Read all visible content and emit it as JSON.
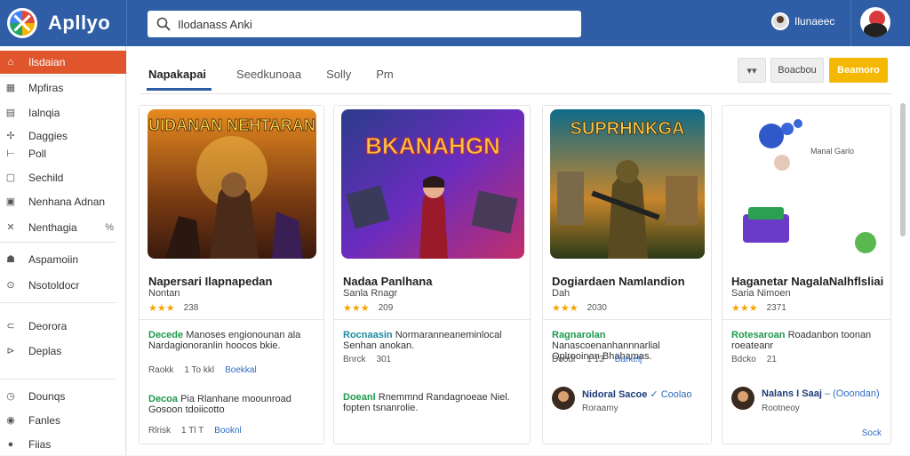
{
  "app": {
    "name": "Apllyo",
    "accent": "#2f5ea6",
    "active_color": "#e0552c",
    "primary_btn": "#f5b800"
  },
  "search": {
    "value": "Ilodanass Anki",
    "icon": "search-icon"
  },
  "user": {
    "name": "Ilunaeec"
  },
  "sidebar": {
    "items": [
      {
        "label": "Ilsdaian",
        "icon": "home-icon"
      },
      {
        "label": "Mpfiras",
        "icon": "grid-icon"
      },
      {
        "label": "Ialnqia",
        "icon": "list-icon"
      },
      {
        "label": "Daggies",
        "icon": "star-icon"
      },
      {
        "label": "Poll",
        "icon": "chart-icon"
      },
      {
        "label": "Sechild",
        "icon": "document-icon"
      },
      {
        "label": "Nenhana Adnan",
        "icon": "box-icon"
      },
      {
        "label": "Nenthagia",
        "icon": "cross-icon",
        "extra": "%"
      },
      {
        "label": "Aspamoiin",
        "icon": "user-icon"
      },
      {
        "label": "Nsotoldocr",
        "icon": "gear-icon"
      },
      {
        "label": "Deorora",
        "icon": "at-icon"
      },
      {
        "label": "Deplas",
        "icon": "share-icon"
      },
      {
        "label": "Dounqs",
        "icon": "clock-icon"
      },
      {
        "label": "Fanles",
        "icon": "circle-icon"
      },
      {
        "label": "Fiias",
        "icon": "dot-icon"
      }
    ]
  },
  "tabs": [
    {
      "label": "Napakapai"
    },
    {
      "label": "Seedkunoaa"
    },
    {
      "label": "Solly"
    },
    {
      "label": "Pm"
    }
  ],
  "toolbar": {
    "filter_label": "▾▾",
    "secondary_label": "Boacbou",
    "primary_label": "Beamoro"
  },
  "cards": [
    {
      "banner": "UIDANAN NEHTARAN",
      "colors": [
        "#7a3b12",
        "#e78a1f",
        "#3a1a0e"
      ],
      "title": "Napersari Ilapnapedan",
      "subtitle": "Nontan",
      "stars": "★★★",
      "rating": "238",
      "post1_hl": "Decede",
      "post1_text": "Manoses engionounan ala Nardagionoranlin hoocos bkie.",
      "meta1": {
        "a": "Raokk",
        "b": "1 To kkl",
        "c": "Boekkal"
      },
      "post2_hl": "Decoa",
      "post2_text": "Pia Rlanhane moounroad Gosoon tdoiicotto",
      "meta2": {
        "a": "Rlrisk",
        "b": "1 Tl T",
        "c": "Booknl"
      }
    },
    {
      "banner": "BKANAHGN",
      "colors": [
        "#2b3c8a",
        "#c22e6a",
        "#6a2cbf"
      ],
      "title": "Nadaa Panlhana",
      "subtitle": "Sanla Rnagr",
      "stars": "★★★",
      "rating": "209",
      "post1_hl": "Rocnaasin",
      "post1_text": "Normaranneaneminlocal Senhan anokan.",
      "meta1": {
        "a": "Bnrck",
        "b": "301"
      },
      "post2_hl": "Doeanl",
      "post2_text": "Rnemmnd Randagnoeae Niel. fopten tsnanrolie.",
      "meta2": {}
    },
    {
      "banner": "SUPRHNKGA",
      "colors": [
        "#0e6a88",
        "#c7862c",
        "#2a3a18"
      ],
      "title": "Dogiardaen Namlandion",
      "subtitle": "Dah",
      "stars": "★★★",
      "rating": "2030",
      "post1_hl": "Ragnarolan",
      "post1_text": "Nanascoenanhannnarlial Oplrooinan Bhahamas.",
      "meta1": {
        "a": "Doodr",
        "b": "1 13",
        "c": "Barkelj"
      },
      "author_name": "Nidoral Sacoe",
      "author_link": "✓ Coolao",
      "author_sub": "Roraamy"
    },
    {
      "banner": "",
      "colors": [
        "#ffffff",
        "#ffffff",
        "#ffffff"
      ],
      "title": "Haganetar NagalaNalhflsliai",
      "subtitle": "Saria Nimoen",
      "stars": "★★★",
      "rating": "2371",
      "post1_hl": "Rotesaroan",
      "post1_text": "Roadanbon toonan roeateanr",
      "meta1": {
        "a": "Bdcko",
        "b": "21"
      },
      "author_name": "Nalans I Saaj",
      "author_link": "– (Ooondan)",
      "author_sub": "Rootneoy",
      "overlay_text": "Manal Garlo",
      "foot": "Sock"
    }
  ]
}
